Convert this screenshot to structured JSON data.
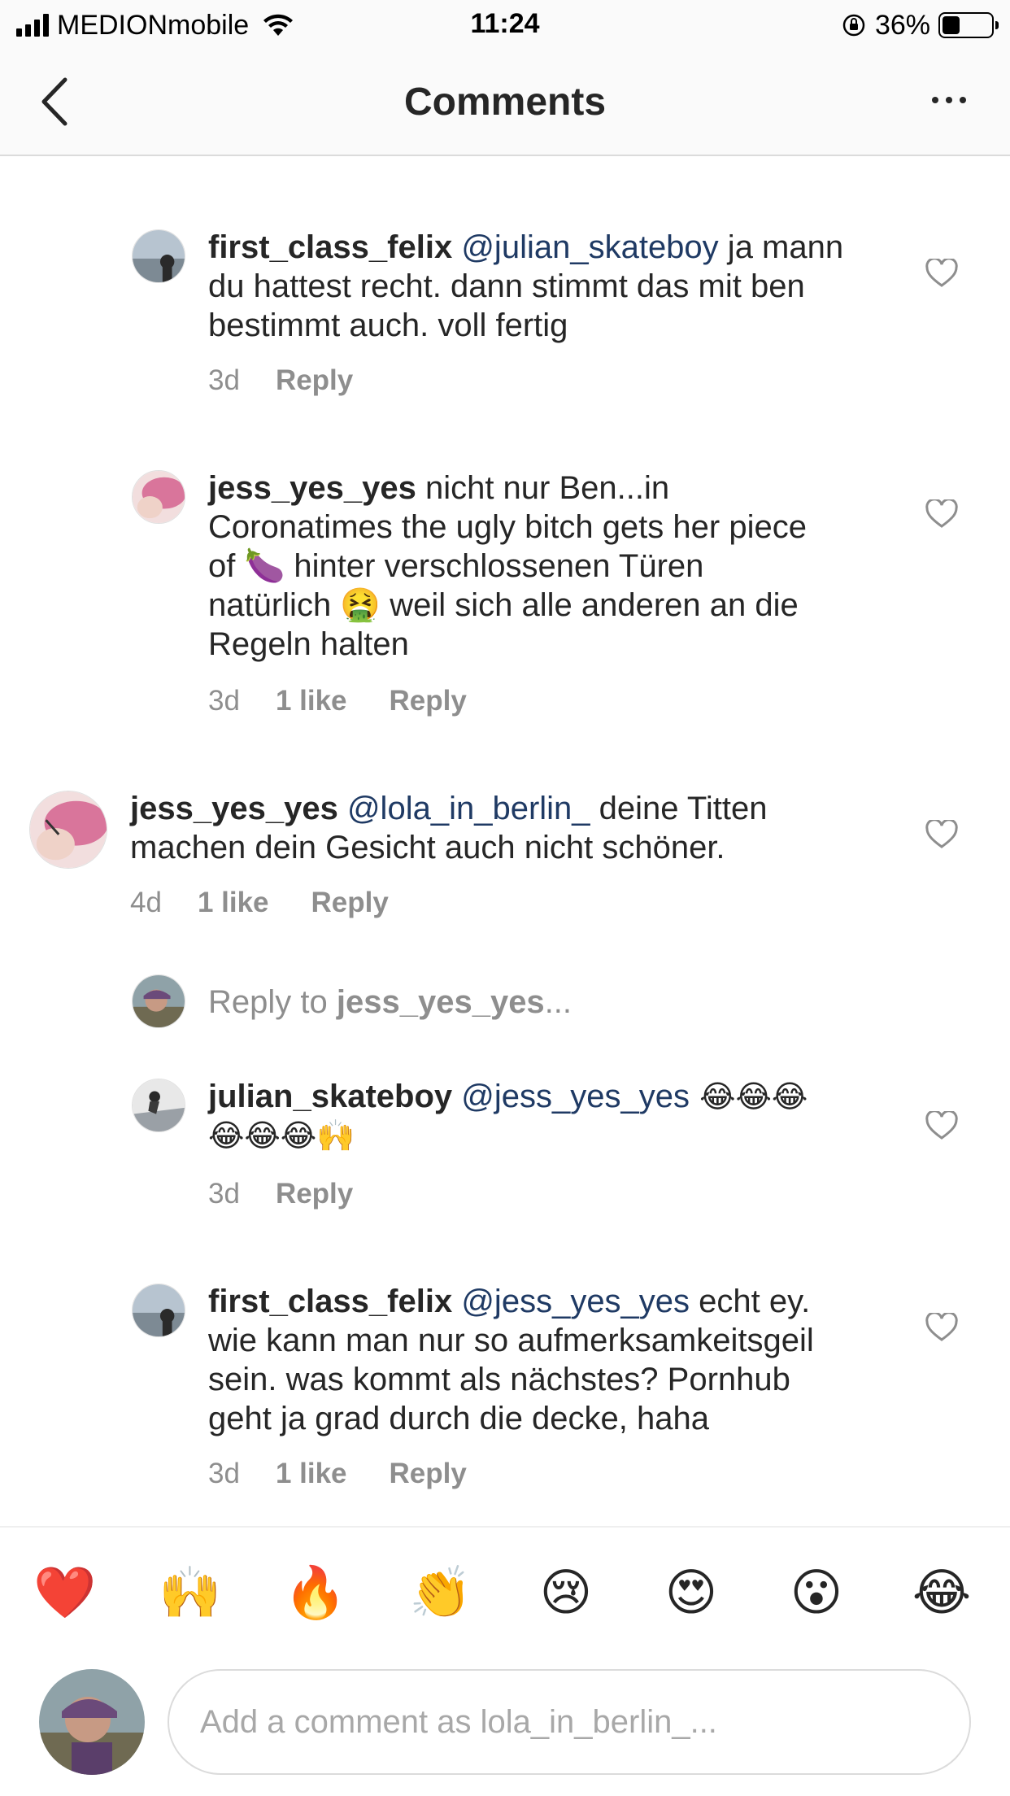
{
  "status_bar": {
    "carrier": "MEDIONmobile",
    "time": "11:24",
    "battery_percent": "36%",
    "battery_level": 0.36
  },
  "header": {
    "title": "Comments",
    "back_icon": "chevron-left-icon",
    "more_icon": "more-horizontal-icon"
  },
  "comments": [
    {
      "username": "first_class_felix",
      "mention": "@julian_skateboy",
      "text_lines": [
        " ja mann",
        "du hattest recht. dann stimmt das mit ben",
        "bestimmt auch. voll fertig"
      ],
      "time": "3d",
      "likes": "",
      "reply_label": "Reply"
    },
    {
      "username": "jess_yes_yes",
      "mention": "",
      "text_lines": [
        " nicht nur Ben...in",
        "Coronatimes the ugly bitch gets her piece",
        "of 🍆 hinter verschlossenen Türen",
        "natürlich 🤮 weil sich alle anderen an die",
        "Regeln halten"
      ],
      "time": "3d",
      "likes": "1 like",
      "reply_label": "Reply"
    },
    {
      "username": "jess_yes_yes",
      "mention": "@lola_in_berlin_",
      "text_lines": [
        " deine Titten",
        "machen dein Gesicht auch nicht schöner."
      ],
      "time": "4d",
      "likes": "1 like",
      "reply_label": "Reply"
    },
    {
      "username": "julian_skateboy",
      "mention": "@jess_yes_yes",
      "text_lines": [
        " 😂😂😂",
        "😂😂😂🙌"
      ],
      "time": "3d",
      "likes": "",
      "reply_label": "Reply"
    },
    {
      "username": "first_class_felix",
      "mention": "@jess_yes_yes",
      "text_lines": [
        " echt ey.",
        "wie kann man nur so aufmerksamkeitsgeil",
        "sein. was kommt als nächstes? Pornhub",
        "geht ja grad durch die decke, haha"
      ],
      "time": "3d",
      "likes": "1 like",
      "reply_label": "Reply"
    }
  ],
  "reply_to": {
    "prefix": "Reply to ",
    "username": "jess_yes_yes",
    "suffix": "..."
  },
  "emoji_bar": [
    "❤️",
    "🙌",
    "🔥",
    "👏",
    "😢",
    "😍",
    "😮",
    "😂"
  ],
  "composer": {
    "placeholder": "Add a comment as lola_in_berlin_..."
  },
  "colors": {
    "text": "#262626",
    "mention": "#1f3a64",
    "meta": "#8e8e8e",
    "divider": "#dbdbdb"
  }
}
